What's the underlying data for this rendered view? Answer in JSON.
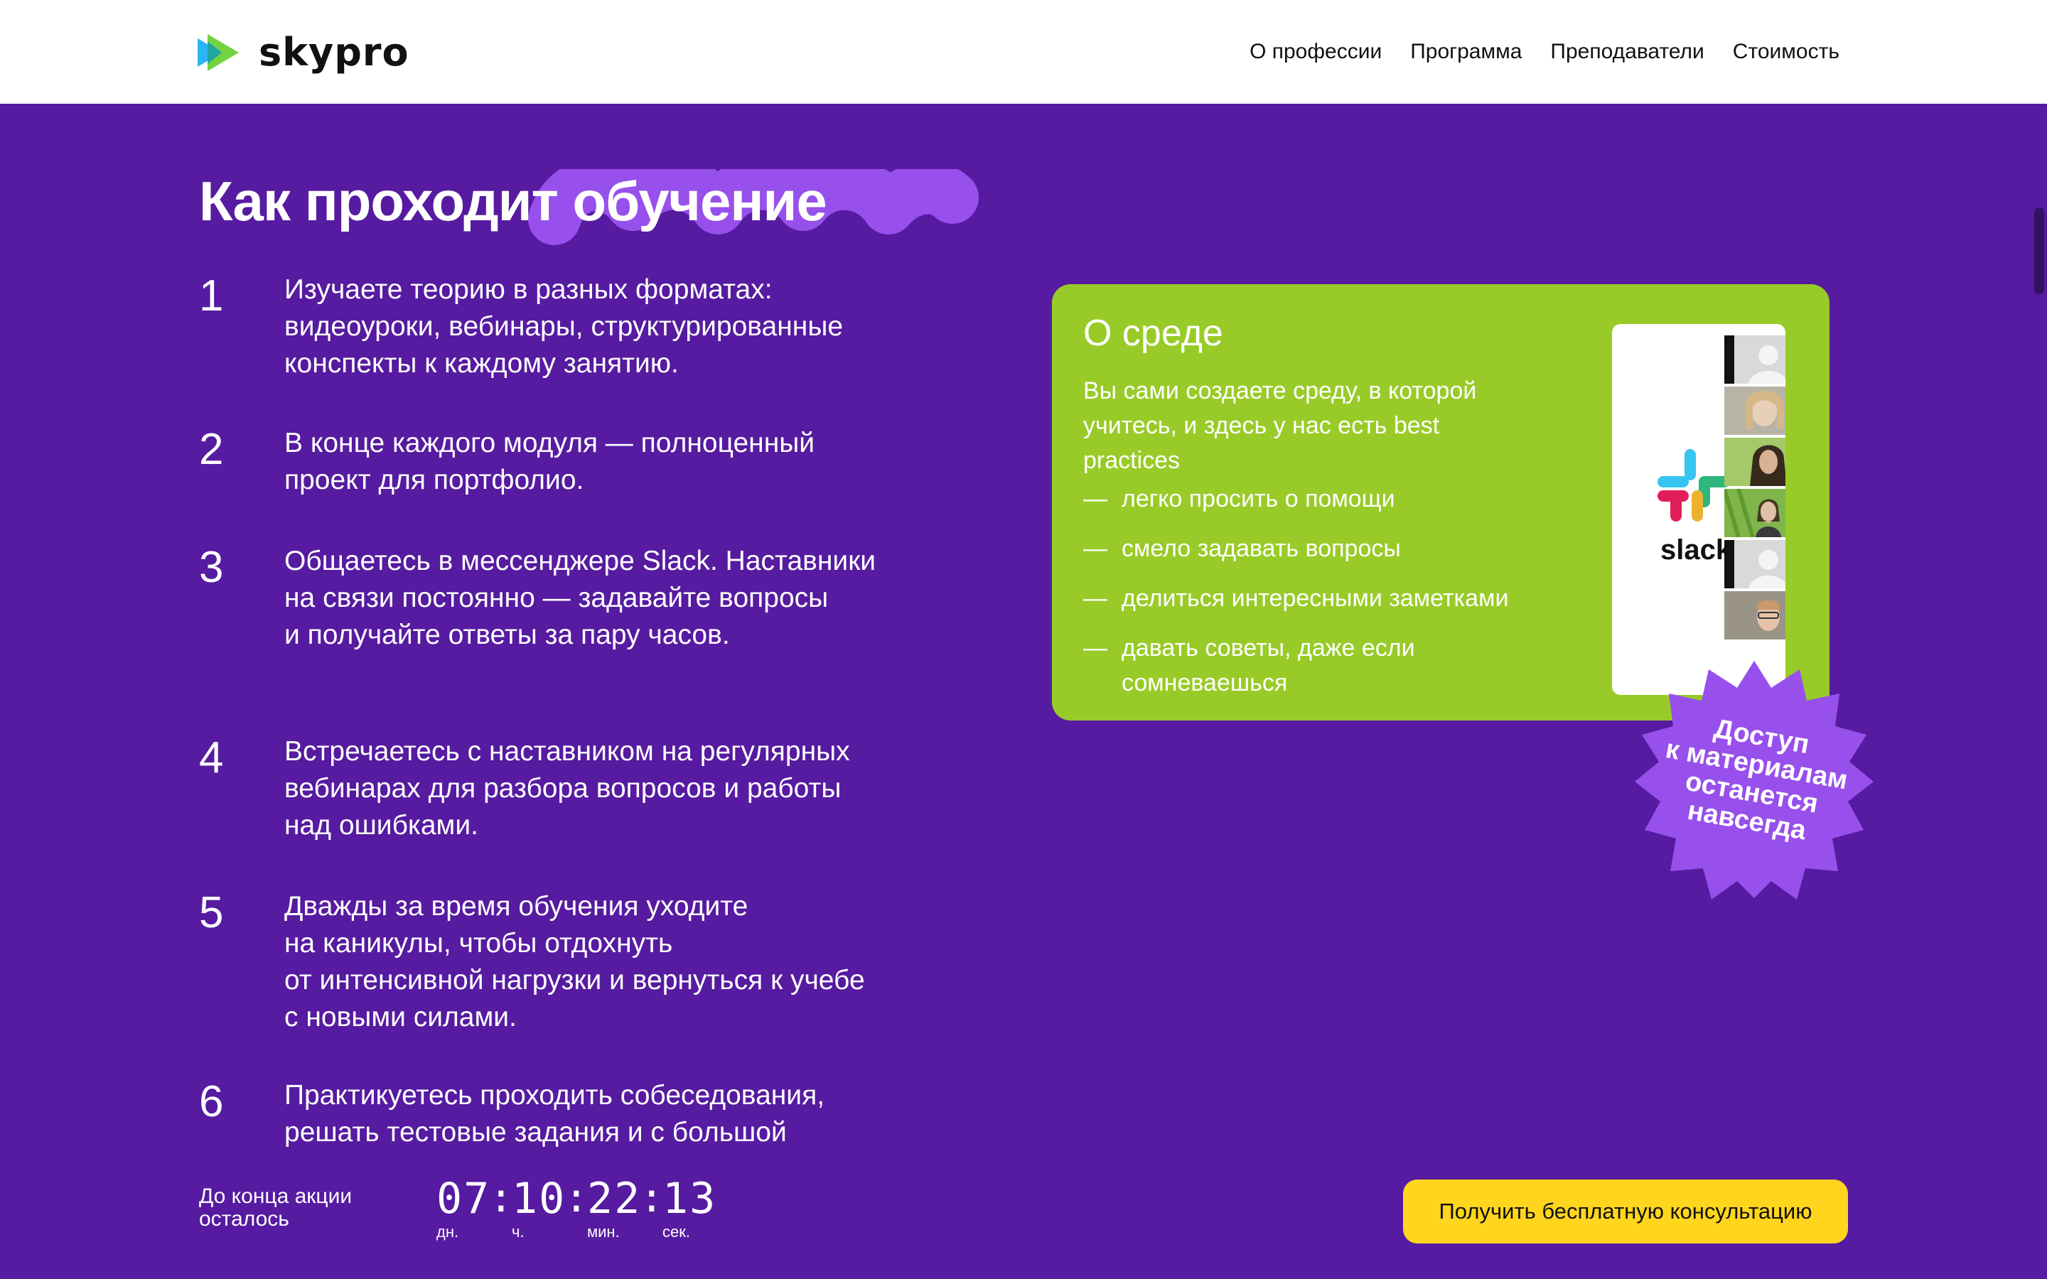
{
  "header": {
    "logo_text": "skypro",
    "nav": [
      {
        "label": "О профессии"
      },
      {
        "label": "Программа"
      },
      {
        "label": "Преподаватели"
      },
      {
        "label": "Стоимость"
      }
    ]
  },
  "section": {
    "title": "Как проходит обучение",
    "steps": [
      {
        "num": "1",
        "text": "Изучаете теорию в разных форматах:\nвидеоуроки, вебинары, структурированные\nконспекты к каждому занятию."
      },
      {
        "num": "2",
        "text": "В конце каждого модуля — полноценный\nпроект для портфолио."
      },
      {
        "num": "3",
        "text": "Общаетесь в мессенджере Slack. Наставники\nна связи постоянно — задавайте вопросы\nи получайте ответы за пару часов."
      },
      {
        "num": "4",
        "text": "Встречаетесь с наставником на регулярных\nвебинарах для разбора вопросов и работы\nнад ошибками."
      },
      {
        "num": "5",
        "text": "Дважды за время обучения уходите\nна каникулы, чтобы отдохнуть\nот интенсивной нагрузки и вернуться к учебе\nс новыми силами."
      },
      {
        "num": "6",
        "text": "Практикуетесь проходить собеседования,\nрешать тестовые задания и с большой"
      }
    ]
  },
  "card": {
    "title": "О среде",
    "lead": "Вы сами создаете среду, в которой\nучитесь, и здесь у нас есть best\npractices",
    "items": [
      {
        "dash": "—",
        "text": "легко просить о помощи"
      },
      {
        "dash": "—",
        "text": "смело задавать вопросы"
      },
      {
        "dash": "—",
        "text": "делиться интересными заметками"
      },
      {
        "dash": "—",
        "text": "давать советы, даже если\nсомневаешься"
      }
    ],
    "slack_word": "slack",
    "badge": "Доступ\nк материалам\nостанется\nнавсегда"
  },
  "countdown": {
    "label": "До конца акции\nосталось",
    "days": "07",
    "days_label": "дн.",
    "hours": "10",
    "hours_label": "ч.",
    "minutes": "22",
    "minutes_label": "мин.",
    "seconds": "13",
    "seconds_label": "сек.",
    "sep": ":"
  },
  "cta": {
    "label": "Получить бесплатную консультацию"
  },
  "colors": {
    "background": "#561BA0",
    "accent_lime": "#99CB28",
    "accent_purple": "#9750EB",
    "cta_yellow": "#FFD51D"
  }
}
